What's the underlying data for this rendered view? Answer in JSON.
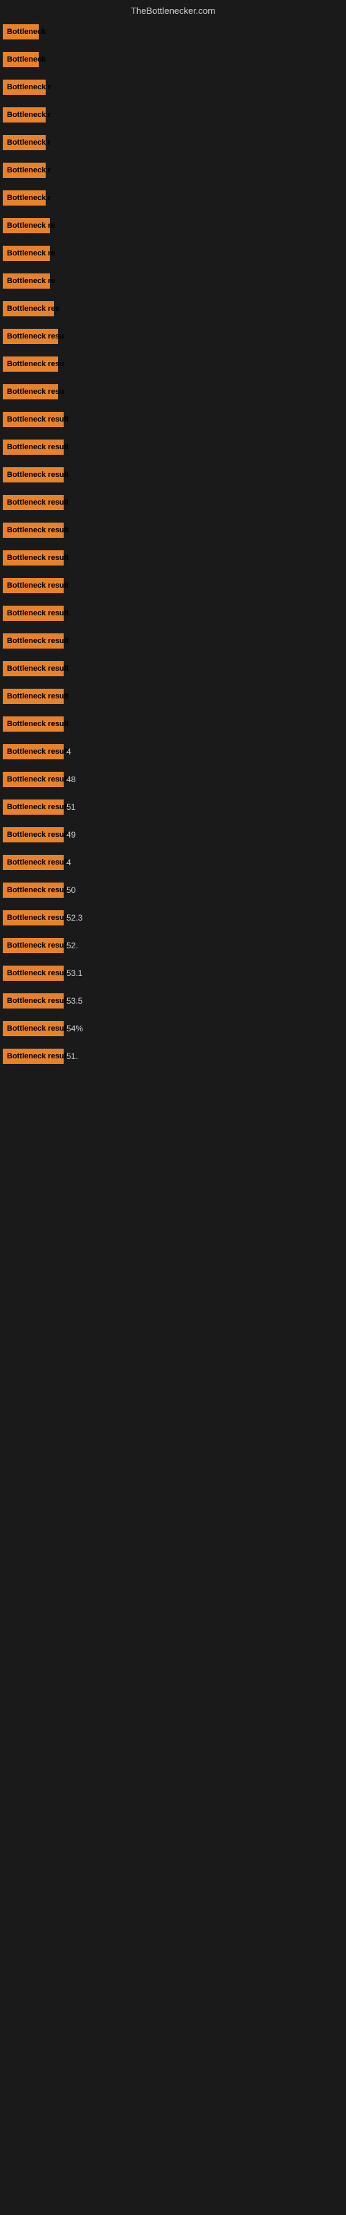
{
  "header": {
    "title": "TheBottlenecker.com"
  },
  "bars": [
    {
      "label": "Bottleneck",
      "width": 52,
      "value": ""
    },
    {
      "label": "Bottleneck",
      "width": 52,
      "value": ""
    },
    {
      "label": "Bottleneck r",
      "width": 62,
      "value": ""
    },
    {
      "label": "Bottleneck r",
      "width": 62,
      "value": ""
    },
    {
      "label": "Bottleneck r",
      "width": 62,
      "value": ""
    },
    {
      "label": "Bottleneck r",
      "width": 62,
      "value": ""
    },
    {
      "label": "Bottleneck r",
      "width": 62,
      "value": ""
    },
    {
      "label": "Bottleneck re",
      "width": 68,
      "value": ""
    },
    {
      "label": "Bottleneck re",
      "width": 68,
      "value": ""
    },
    {
      "label": "Bottleneck re",
      "width": 68,
      "value": ""
    },
    {
      "label": "Bottleneck res",
      "width": 74,
      "value": ""
    },
    {
      "label": "Bottleneck resu",
      "width": 80,
      "value": ""
    },
    {
      "label": "Bottleneck resu",
      "width": 80,
      "value": ""
    },
    {
      "label": "Bottleneck resu",
      "width": 80,
      "value": ""
    },
    {
      "label": "Bottleneck result",
      "width": 88,
      "value": ""
    },
    {
      "label": "Bottleneck result",
      "width": 88,
      "value": ""
    },
    {
      "label": "Bottleneck result",
      "width": 88,
      "value": ""
    },
    {
      "label": "Bottleneck result",
      "width": 88,
      "value": ""
    },
    {
      "label": "Bottleneck result",
      "width": 88,
      "value": ""
    },
    {
      "label": "Bottleneck result",
      "width": 88,
      "value": ""
    },
    {
      "label": "Bottleneck result",
      "width": 88,
      "value": ""
    },
    {
      "label": "Bottleneck result",
      "width": 88,
      "value": ""
    },
    {
      "label": "Bottleneck result",
      "width": 88,
      "value": ""
    },
    {
      "label": "Bottleneck result",
      "width": 88,
      "value": ""
    },
    {
      "label": "Bottleneck result",
      "width": 88,
      "value": ""
    },
    {
      "label": "Bottleneck result",
      "width": 88,
      "value": ""
    },
    {
      "label": "Bottleneck result",
      "width": 88,
      "value": "4"
    },
    {
      "label": "Bottleneck result",
      "width": 88,
      "value": "48"
    },
    {
      "label": "Bottleneck result",
      "width": 88,
      "value": "51"
    },
    {
      "label": "Bottleneck result",
      "width": 88,
      "value": "49"
    },
    {
      "label": "Bottleneck result",
      "width": 88,
      "value": "4"
    },
    {
      "label": "Bottleneck result",
      "width": 88,
      "value": "50"
    },
    {
      "label": "Bottleneck result",
      "width": 88,
      "value": "52.3"
    },
    {
      "label": "Bottleneck result",
      "width": 88,
      "value": "52."
    },
    {
      "label": "Bottleneck result",
      "width": 88,
      "value": "53.1"
    },
    {
      "label": "Bottleneck result",
      "width": 88,
      "value": "53.5"
    },
    {
      "label": "Bottleneck result",
      "width": 88,
      "value": "54%"
    },
    {
      "label": "Bottleneck result",
      "width": 88,
      "value": "51."
    }
  ]
}
